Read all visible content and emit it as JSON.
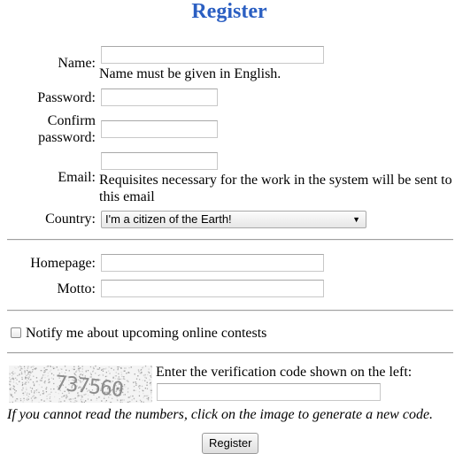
{
  "page_title": "Register",
  "form": {
    "name": {
      "label": "Name:",
      "value": "",
      "note": "Name must be given in English."
    },
    "password": {
      "label": "Password:",
      "value": ""
    },
    "confirm": {
      "label_line1": "Confirm",
      "label_line2": "password:",
      "value": ""
    },
    "email": {
      "label": "Email:",
      "value": "",
      "note_line1": "Requisites necessary for the work in the system will be sent to",
      "note_line2": "this email"
    },
    "country": {
      "label": "Country:",
      "selected": "I'm a citizen of the Earth!",
      "arrow_icon": "triangle-down-icon"
    },
    "homepage": {
      "label": "Homepage:",
      "value": ""
    },
    "motto": {
      "label": "Motto:",
      "value": ""
    },
    "notify": {
      "label": "Notify me about upcoming online contests",
      "checked": false
    },
    "captcha": {
      "code": "737560",
      "instruction": "Enter the verification code shown on the left:",
      "value": "",
      "hint": "If you cannot read the numbers, click on the image to generate a new code."
    },
    "submit_label": "Register"
  }
}
